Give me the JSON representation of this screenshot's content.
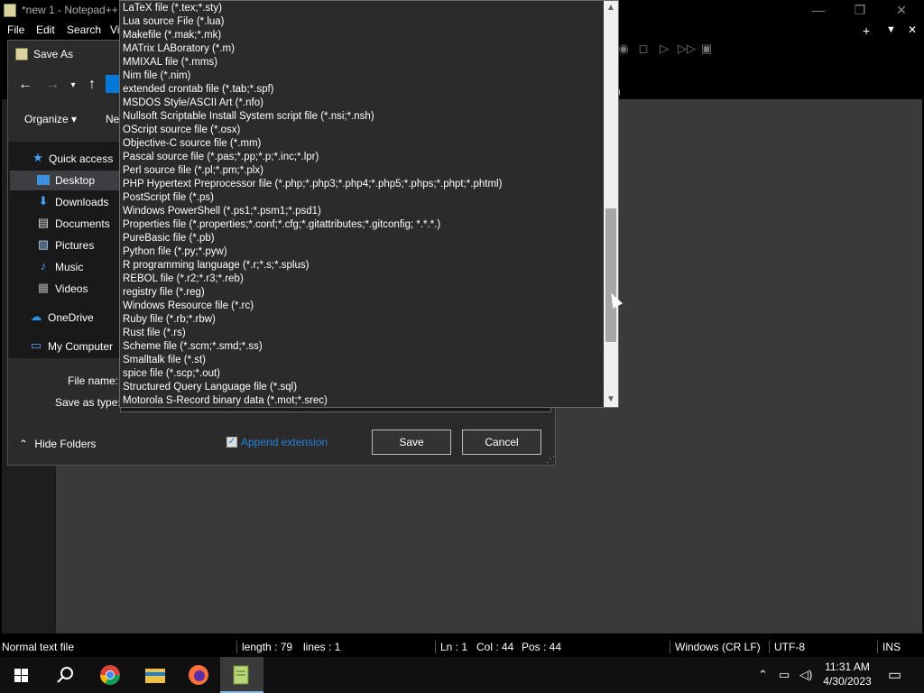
{
  "notepad": {
    "title": "*new 1 - Notepad++",
    "menu": [
      "File",
      "Edit",
      "Search",
      "Vi"
    ],
    "tab_fragment": ")",
    "window_controls": {
      "minimize": "—",
      "maximize": "❐",
      "close": "✕"
    },
    "toolbar_right": {
      "plus": "+",
      "dropdown": "▼",
      "close": "✕"
    }
  },
  "dialog": {
    "title": "Save As",
    "organize": "Organize ▾",
    "new_folder_fragment": "Ne",
    "nav_items": [
      {
        "label": "Quick access",
        "icon": "star-icon"
      },
      {
        "label": "Desktop",
        "icon": "desktop-folder-icon"
      },
      {
        "label": "Downloads",
        "icon": "download-arrow-icon"
      },
      {
        "label": "Documents",
        "icon": "documents-icon"
      },
      {
        "label": "Pictures",
        "icon": "pictures-icon"
      },
      {
        "label": "Music",
        "icon": "music-note-icon"
      },
      {
        "label": "Videos",
        "icon": "videos-icon"
      },
      {
        "label": "OneDrive",
        "icon": "cloud-icon"
      },
      {
        "label": "My Computer",
        "icon": "computer-icon"
      }
    ],
    "file_name_label": "File name:",
    "save_as_type_label": "Save as type:",
    "hide_folders": "Hide Folders",
    "append_extension": "Append extension",
    "append_checked": true,
    "save": "Save",
    "cancel": "Cancel"
  },
  "file_types": [
    "LaTeX file (*.tex;*.sty)",
    "Lua source File (*.lua)",
    "Makefile (*.mak;*.mk)",
    "MATrix LABoratory (*.m)",
    "MMIXAL file (*.mms)",
    "Nim file (*.nim)",
    "extended crontab file (*.tab;*.spf)",
    "MSDOS Style/ASCII Art (*.nfo)",
    "Nullsoft Scriptable Install System script file (*.nsi;*.nsh)",
    "OScript source file (*.osx)",
    "Objective-C source file (*.mm)",
    "Pascal source file (*.pas;*.pp;*.p;*.inc;*.lpr)",
    "Perl source file (*.pl;*.pm;*.plx)",
    "PHP Hypertext Preprocessor file (*.php;*.php3;*.php4;*.php5;*.phps;*.phpt;*.phtml)",
    "PostScript file (*.ps)",
    "Windows PowerShell (*.ps1;*.psm1;*.psd1)",
    "Properties file (*.properties;*.conf;*.cfg;*.gitattributes;*.gitconfig; *.*.*.)",
    "PureBasic file (*.pb)",
    "Python file (*.py;*.pyw)",
    "R programming language (*.r;*.s;*.splus)",
    "REBOL file (*.r2;*.r3;*.reb)",
    "registry file (*.reg)",
    "Windows Resource file (*.rc)",
    "Ruby file (*.rb;*.rbw)",
    "Rust file (*.rs)",
    "Scheme file (*.scm;*.smd;*.ss)",
    "Smalltalk file (*.st)",
    "spice file (*.scp;*.out)",
    "Structured Query Language file (*.sql)",
    "Motorola S-Record binary data (*.mot;*.srec)"
  ],
  "statusbar": {
    "type": "Normal text file",
    "length": "length : 79",
    "lines": "lines : 1",
    "ln": "Ln : 1",
    "col": "Col : 44",
    "pos": "Pos : 44",
    "eol": "Windows (CR LF)",
    "encoding": "UTF-8",
    "mode": "INS"
  },
  "taskbar": {
    "time": "11:31 AM",
    "date": "4/30/2023",
    "apps": [
      "start-icon",
      "search-icon",
      "chrome-icon",
      "file-explorer-icon",
      "firefox-icon",
      "notepadpp-icon"
    ]
  }
}
